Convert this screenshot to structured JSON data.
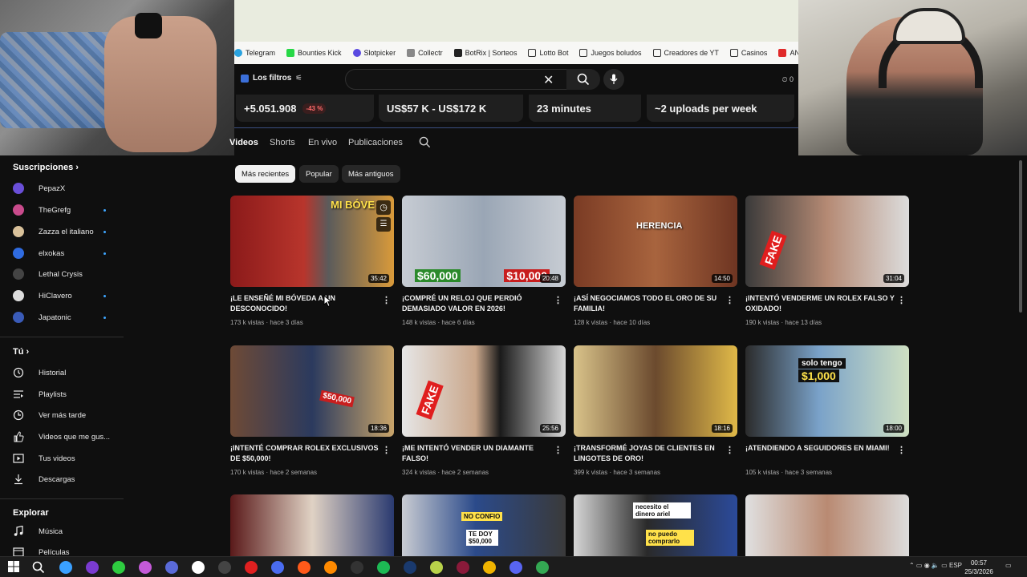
{
  "bookmarks": [
    "Telegram",
    "Bounties Kick",
    "Slotpicker",
    "Collectr",
    "BotRix | Sorteos",
    "Lotto Bot",
    "Juegos boludos",
    "Creadores de YT",
    "Casinos",
    "ANTES de jugar R"
  ],
  "header": {
    "logo_text": "Los filtros",
    "right_count": "0"
  },
  "stats": [
    "+5.051.908",
    "-43 %",
    "US$57 K - US$172 K",
    "23 minutes",
    "~2 uploads per week"
  ],
  "tabs": [
    "Videos",
    "Shorts",
    "En vivo",
    "Publicaciones"
  ],
  "chips": [
    "Más recientes",
    "Popular",
    "Más antiguos"
  ],
  "sidebar": {
    "subs_title": "Suscripciones",
    "subs": [
      {
        "label": "PepazX",
        "color": "#6a4fd8",
        "dot": false
      },
      {
        "label": "TheGrefg",
        "color": "#c94b8c",
        "dot": true
      },
      {
        "label": "Zazza el italiano",
        "color": "#d9c19a",
        "dot": true
      },
      {
        "label": "elxokas",
        "color": "#2f6be0",
        "dot": true
      },
      {
        "label": "Lethal Crysis",
        "color": "#444444",
        "dot": false
      },
      {
        "label": "HiClavero",
        "color": "#dddddd",
        "dot": true
      },
      {
        "label": "Japatonic",
        "color": "#3a5bb8",
        "dot": true
      }
    ],
    "you_title": "Tú",
    "you": [
      {
        "label": "Historial",
        "icon": "history-icon"
      },
      {
        "label": "Playlists",
        "icon": "playlists-icon"
      },
      {
        "label": "Ver más tarde",
        "icon": "watch-later-icon"
      },
      {
        "label": "Videos que me gus...",
        "icon": "like-icon"
      },
      {
        "label": "Tus videos",
        "icon": "your-videos-icon"
      },
      {
        "label": "Descargas",
        "icon": "downloads-icon"
      }
    ],
    "explore_title": "Explorar",
    "explore": [
      {
        "label": "Música",
        "icon": "music-icon"
      },
      {
        "label": "Películas",
        "icon": "movies-icon"
      }
    ]
  },
  "videos": [
    {
      "title": "¡LE ENSEÑÉ MI BÓVEDA A UN DESCONOCIDO!",
      "meta": "173 k vistas · hace 3 días",
      "dur": "35:42",
      "overlay": "MI BÓVE",
      "bg": "linear-gradient(90deg,#8b1a1a 0%,#b8352c 45%,#5b5b5b 60%,#d99a3a 100%)"
    },
    {
      "title": "¡COMPRÉ UN RELOJ QUE PERDIÓ DEMASIADO VALOR EN 2026!",
      "meta": "148 k vistas · hace 6 días",
      "dur": "20:48",
      "overlay": "$60,000",
      "overlay2": "$10,000",
      "bg": "linear-gradient(90deg,#c7ccd3 0%,#9aa6b5 50%,#c7ccd3 100%)"
    },
    {
      "title": "¡ASÍ NEGOCIAMOS TODO EL ORO DE SU FAMILIA!",
      "meta": "128 k vistas · hace 10 días",
      "dur": "14:50",
      "overlay": "HERENCIA",
      "bg": "linear-gradient(90deg,#7a3b24 0%,#a8643e 50%,#6e3522 100%)"
    },
    {
      "title": "¡INTENTÓ VENDERME UN ROLEX FALSO Y OXIDADO!",
      "meta": "190 k vistas · hace 13 días",
      "dur": "31:04",
      "overlay": "FAKE",
      "bg": "linear-gradient(90deg,#3a3a3a 0%,#b58a74 50%,#dcdcdc 100%)"
    },
    {
      "title": "¡INTENTÉ COMPRAR ROLEX EXCLUSIVOS DE $50,000!",
      "meta": "170 k vistas · hace 2 semanas",
      "dur": "18:36",
      "overlay": "$50,000",
      "bg": "linear-gradient(90deg,#6e4a36 0%,#2b3a5e 50%,#c9a56a 100%)"
    },
    {
      "title": "¡ME INTENTÓ VENDER UN DIAMANTE FALSO!",
      "meta": "324 k vistas · hace 2 semanas",
      "dur": "25:56",
      "overlay": "FAKE",
      "bg": "linear-gradient(90deg,#e6e6e6 0%,#c9a68a 45%,#1a1a1a 60%,#d8d8d8 100%)"
    },
    {
      "title": "¡TRANSFORMÉ JOYAS DE CLIENTES EN LINGOTES DE ORO!",
      "meta": "399 k vistas · hace 3 semanas",
      "dur": "18:16",
      "overlay": "",
      "bg": "linear-gradient(90deg,#d9c38a 0%,#6b4a2e 50%,#e0b948 100%)"
    },
    {
      "title": "¡ATENDIENDO A SEGUIDORES EN MIAMI!",
      "meta": "105 k vistas · hace 3 semanas",
      "dur": "18:00",
      "overlay": "solo tengo",
      "overlay2": "$1,000",
      "bg": "linear-gradient(90deg,#2b2b2b 0%,#7aa2c9 45%,#cfe0c2 100%)"
    },
    {
      "title": "",
      "meta": "",
      "dur": "",
      "overlay": "",
      "bg": "linear-gradient(90deg,#5a1a1a 0%,#e0d2c4 50%,#2a3a70 100%)"
    },
    {
      "title": "",
      "meta": "",
      "dur": "",
      "overlay": "NO CONFIO",
      "overlay2": "TE DOY $50,000",
      "bg": "linear-gradient(90deg,#c9ccd2 0%,#2b4a8a 45%,#3a3a3a 100%)"
    },
    {
      "title": "",
      "meta": "",
      "dur": "",
      "overlay": "necesito el dinero ariel",
      "overlay2": "no puedo comprarlo",
      "bg": "linear-gradient(90deg,#d6d6d6 0%,#2a2a2a 45%,#2b4a9a 100%)"
    },
    {
      "title": "",
      "meta": "",
      "dur": "",
      "overlay": "",
      "bg": "linear-gradient(90deg,#e0e0e0 0%,#b98a72 50%,#dcdcdc 100%)"
    }
  ],
  "taskbar": {
    "lang": "ESP",
    "time": "00:57",
    "date": "25/3/2026"
  }
}
